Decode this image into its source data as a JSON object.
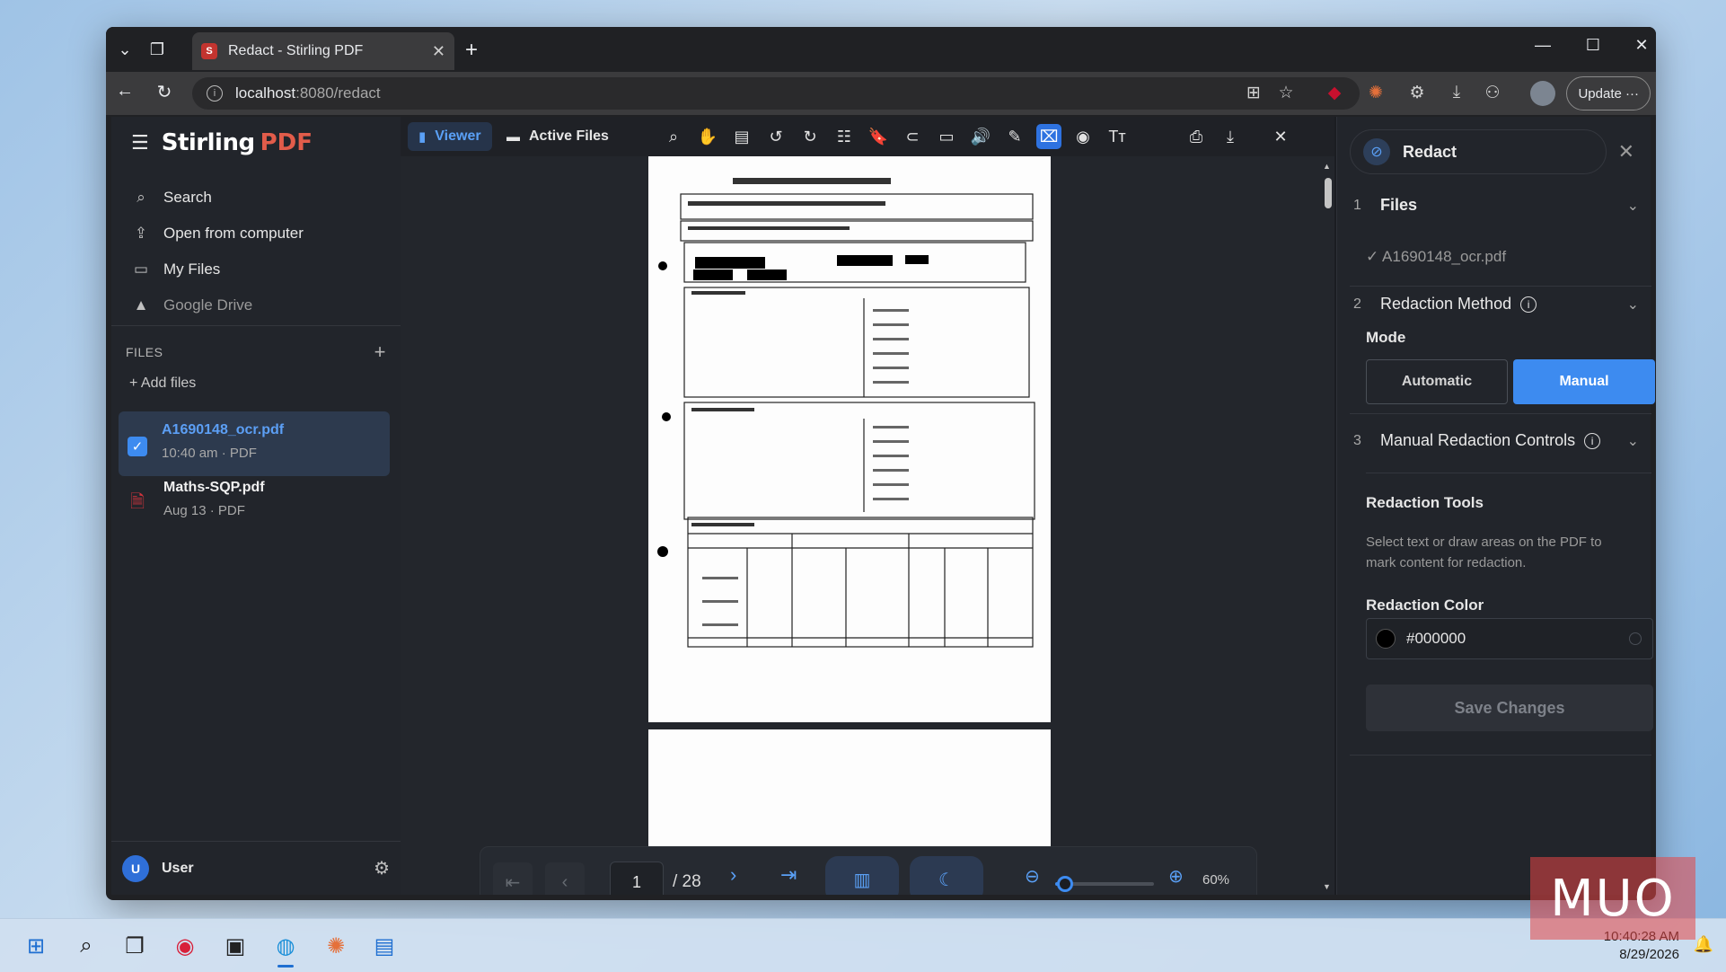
{
  "browser": {
    "tab_title": "Redact - Stirling PDF",
    "tab_favicon": "S",
    "url_host": "localhost",
    "url_path": ":8080/redact",
    "update_label": "Update ···"
  },
  "app": {
    "brand_a": "Stirling",
    "brand_b": "PDF",
    "nav": [
      {
        "label": "Search",
        "icon": "search-icon"
      },
      {
        "label": "Open from computer",
        "icon": "upload-file-icon"
      },
      {
        "label": "My Files",
        "icon": "folder-icon"
      },
      {
        "label": "Google Drive",
        "icon": "google-drive-icon"
      }
    ],
    "files_header": "FILES",
    "add_files": "+ Add files",
    "files": [
      {
        "name": "A1690148_ocr.pdf",
        "meta": "10:40 am · PDF",
        "selected": true
      },
      {
        "name": "Maths-SQP.pdf",
        "meta": "Aug 13 · PDF",
        "selected": false
      }
    ],
    "user": {
      "initial": "U",
      "name": "User"
    }
  },
  "viewer": {
    "tabs": [
      {
        "label": "Viewer",
        "active": true
      },
      {
        "label": "Active Files",
        "active": false
      }
    ],
    "page_current": "1",
    "page_total": "/ 28",
    "zoom": "60%",
    "zoom_level": 0.6
  },
  "redact": {
    "title": "Redact",
    "steps": [
      {
        "num": "1",
        "label": "Files"
      },
      {
        "num": "2",
        "label": "Redaction Method"
      },
      {
        "num": "3",
        "label": "Manual Redaction Controls"
      }
    ],
    "file_selected": "✓ A1690148_ocr.pdf",
    "mode_label": "Mode",
    "mode_automatic": "Automatic",
    "mode_manual": "Manual",
    "tools_title": "Redaction Tools",
    "tools_desc": "Select text or draw areas on the PDF to mark content for redaction.",
    "color_label": "Redaction Color",
    "color_value": "#000000",
    "save_label": "Save Changes"
  },
  "taskbar": {
    "time": "10:40:28 AM",
    "date": "8/29/2026"
  },
  "watermark": "MUO",
  "colors": {
    "accent": "#3d8bf0",
    "brand_red": "#e25c4a",
    "redaction": "#000000"
  }
}
